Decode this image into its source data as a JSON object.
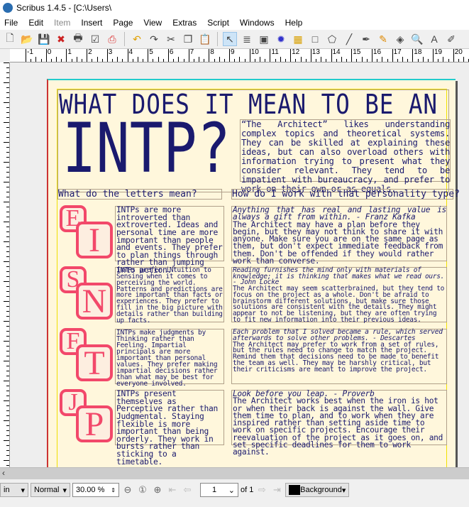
{
  "window": {
    "title": "Scribus 1.4.5 - [C:\\Users\\"
  },
  "menu": [
    "File",
    "Edit",
    "Item",
    "Insert",
    "Page",
    "View",
    "Extras",
    "Script",
    "Windows",
    "Help"
  ],
  "toolbar": [
    "new-icon",
    "open-icon",
    "save-icon",
    "close-icon",
    "print-icon",
    "preflight-icon",
    "pdf-icon",
    "undo-icon",
    "redo-icon",
    "cut-icon",
    "copy-icon",
    "paste-icon",
    "select-icon",
    "text-frame-icon",
    "image-frame-icon",
    "render-frame-icon",
    "table-icon",
    "shape-icon",
    "polygon-icon",
    "line-icon",
    "bezier-icon",
    "freehand-icon",
    "rotate-icon",
    "zoom-icon",
    "edit-text-icon",
    "story-editor-icon"
  ],
  "ruler": {
    "labels": [
      "-1",
      "0",
      "1",
      "2",
      "3",
      "4",
      "5",
      "6",
      "7",
      "8",
      "9",
      "10",
      "11",
      "12",
      "13",
      "14",
      "15",
      "16",
      "17",
      "18",
      "19",
      "20"
    ]
  },
  "doc": {
    "title_line1": "WHAT DOES IT MEAN TO BE AN",
    "title_big": "INTP?",
    "intro": "“The Architect” likes understanding complex topics and theoretical systems. They can be skilled at explaining these ideas, but can also overload others with information trying to present what they consider relevant. They tend to be impatient with bureaucracy, and prefer to work on their own or as equals.",
    "heading_left": "What do the letters mean?",
    "heading_right": "How do I work with that personality type?",
    "rows": [
      {
        "letters": [
          "E",
          "I"
        ],
        "desc": "INTPs are more introverted than extroverted. Ideas and personal time are more important than people and events. They prefer to plan things through rather than jumping into action.",
        "quote": "Anything that has real and lasting value is always a gift from within. - Franz Kafka",
        "advice": "The Architect may have a plan before they begin, but they may not think to share it with anyone. Make sure you are on the same page as them, but don't expect immediate feedback from them. Don't be offended if they would rather work than converse."
      },
      {
        "letters": [
          "S",
          "N"
        ],
        "desc": "INTPs prefer iNtuition to Sensing when it comes to perceiving the world. Patterns and predictions are more important than facts or experiences. They prefer to fill in the big picture with details rather than building up facts.",
        "quote": "Reading furnishes the mind only with materials of knowledge; it is thinking that makes what we read ours. - John Locke",
        "advice": "The Architect may seem scatterbrained, but they tend to focus on the project as a whole. Don't be afraid to brainstorm different solutions, but make sure those solutions are consistent with the details.  They might appear to not be listening, but they are often trying to fit new information into their previous ideas."
      },
      {
        "letters": [
          "F",
          "T"
        ],
        "desc": "INTPs make judgments by Thinking rather than Feeling. Impartial principals are more important than personal values. They prefer making impartial decisions rather than what may be best for everyone involved.",
        "quote": "Each problem that I solved became a rule, which served afterwards to solve other problems. - Descartes",
        "advice": "The Architect may prefer to work from a set of rules, but the rules need to change to match the project. Remind them that decisions need to be made to benefit the team as well. They may be harshly critical, but their criticisms are meant to improve the project."
      },
      {
        "letters": [
          "J",
          "P"
        ],
        "desc": "INTPs present themselves as Perceptive rather than Judgmental. Staying flexible is more important than being orderly. They work in bursts rather than sticking to a timetable.",
        "quote": "Look before you leap. - Proverb",
        "advice": "The Architect works best when the iron is hot or when their back is against the wall. Give them time to plan, and to work when they are inspired rather than setting aside time to work on specific projects. Encourage their reevaluation of the project as it goes on, and set specific deadlines for them to work against."
      }
    ]
  },
  "status": {
    "unit": "in",
    "mode": "Normal",
    "zoom": "30.00 %",
    "page": "1",
    "of": "of 1",
    "layer": "Background",
    "layer_color": "#000000"
  },
  "colors": {
    "accent": "#f2486a",
    "text": "#1a1a6e",
    "paper": "#fff7dc"
  }
}
